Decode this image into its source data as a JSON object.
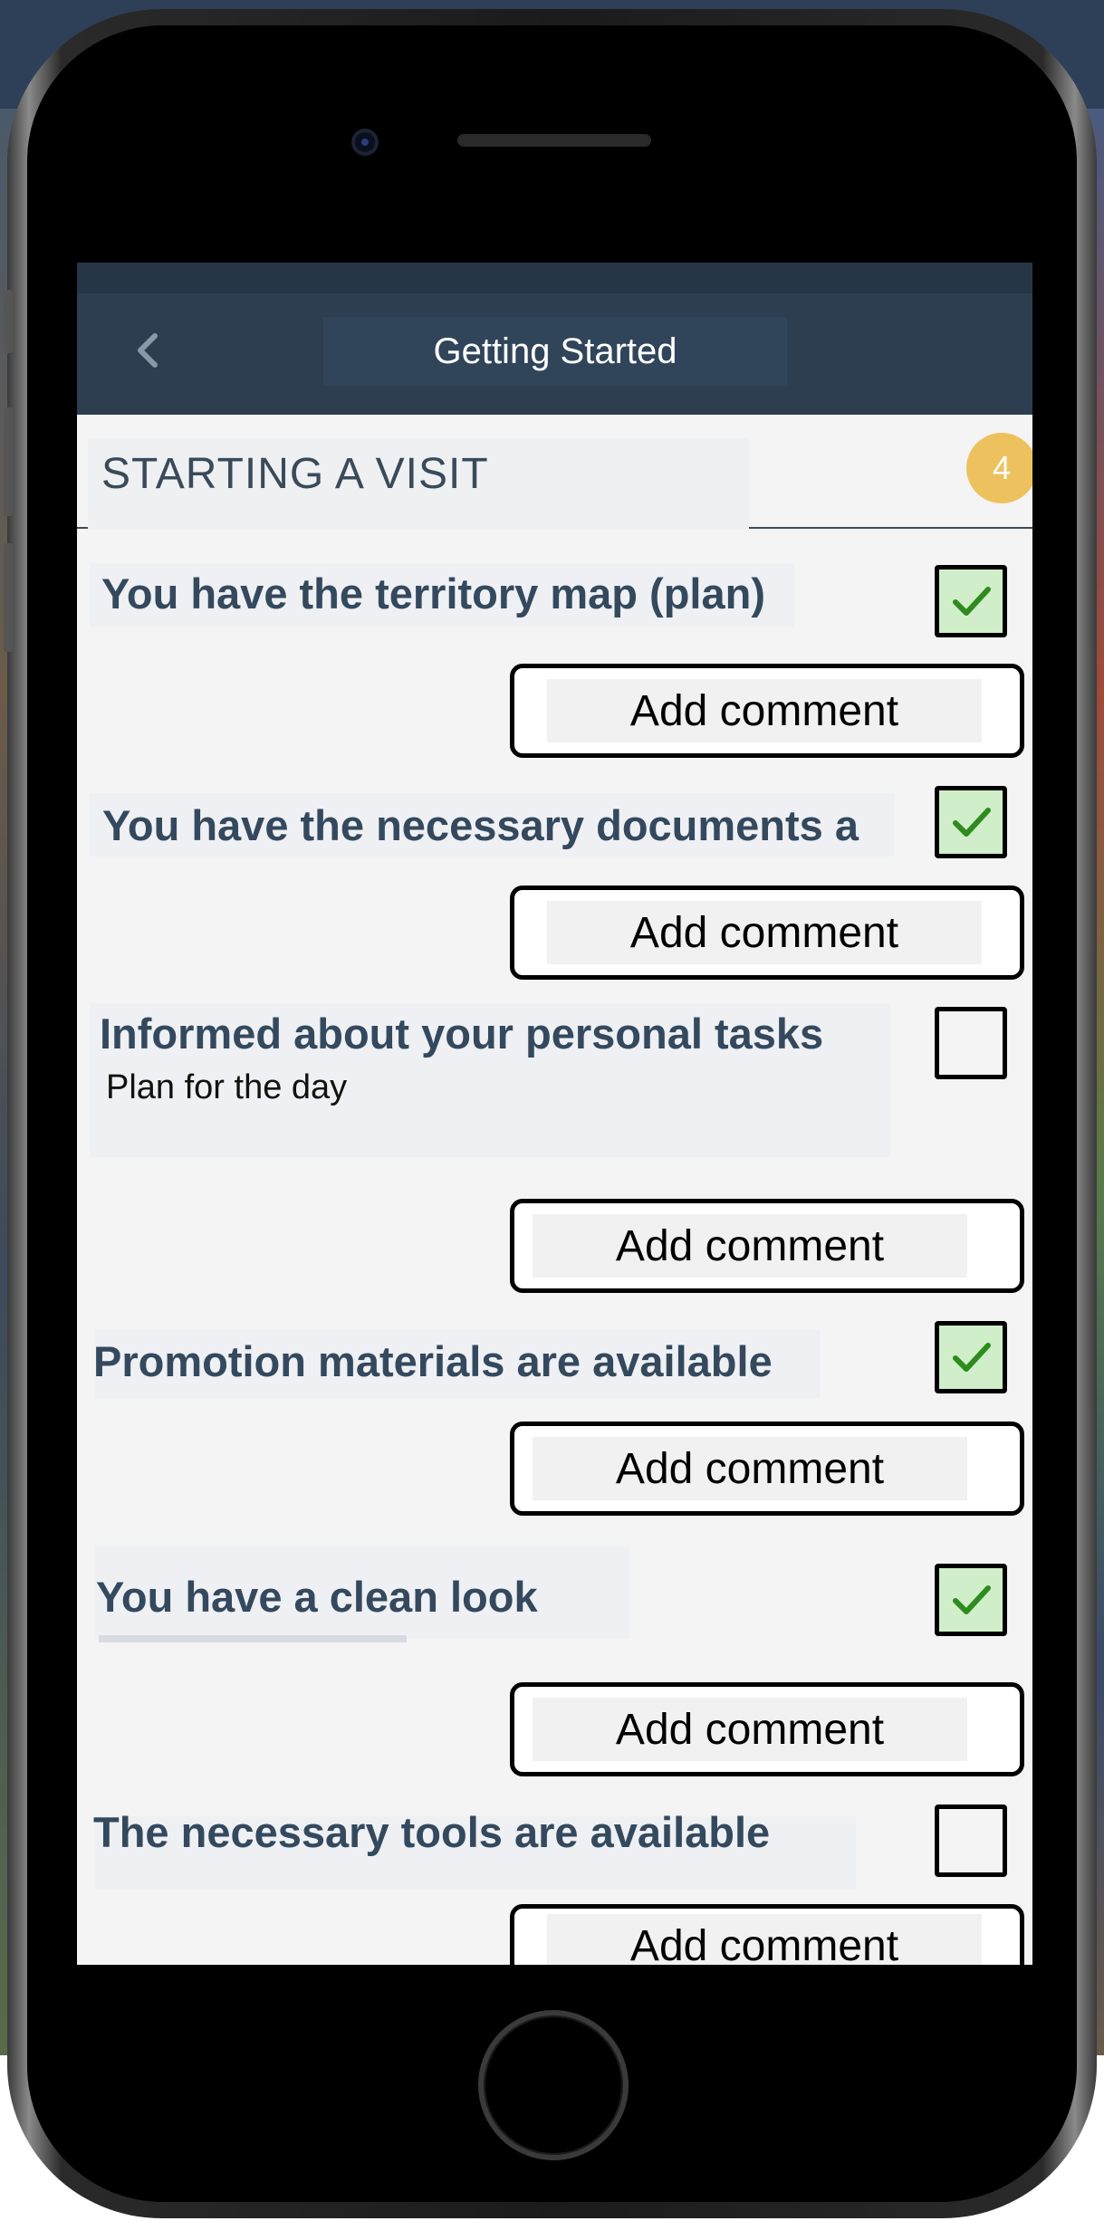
{
  "header": {
    "title": "Getting Started",
    "back_icon": "chevron-left-icon"
  },
  "section": {
    "title": "STARTING A VISIT",
    "badge_count": "4"
  },
  "items": [
    {
      "label": "You have the territory map (plan)",
      "sublabel": "",
      "checked": true,
      "comment_label": "Add comment"
    },
    {
      "label": "You have the necessary documents a",
      "sublabel": "",
      "checked": true,
      "comment_label": "Add comment"
    },
    {
      "label": "Informed about your personal tasks",
      "sublabel": "Plan for the day",
      "checked": false,
      "comment_label": "Add comment"
    },
    {
      "label": "Promotion materials are available",
      "sublabel": "",
      "checked": true,
      "comment_label": "Add comment"
    },
    {
      "label": "You have a clean look",
      "sublabel": "",
      "checked": true,
      "comment_label": "Add comment"
    },
    {
      "label": "The necessary tools are available",
      "sublabel": "",
      "checked": false,
      "comment_label": "Add comment"
    }
  ],
  "colors": {
    "header_bg": "#2c3e50",
    "badge": "#edc25e",
    "check_fill": "#cfeec9",
    "check_mark": "#2e8b1e",
    "label_text": "#34495e"
  }
}
